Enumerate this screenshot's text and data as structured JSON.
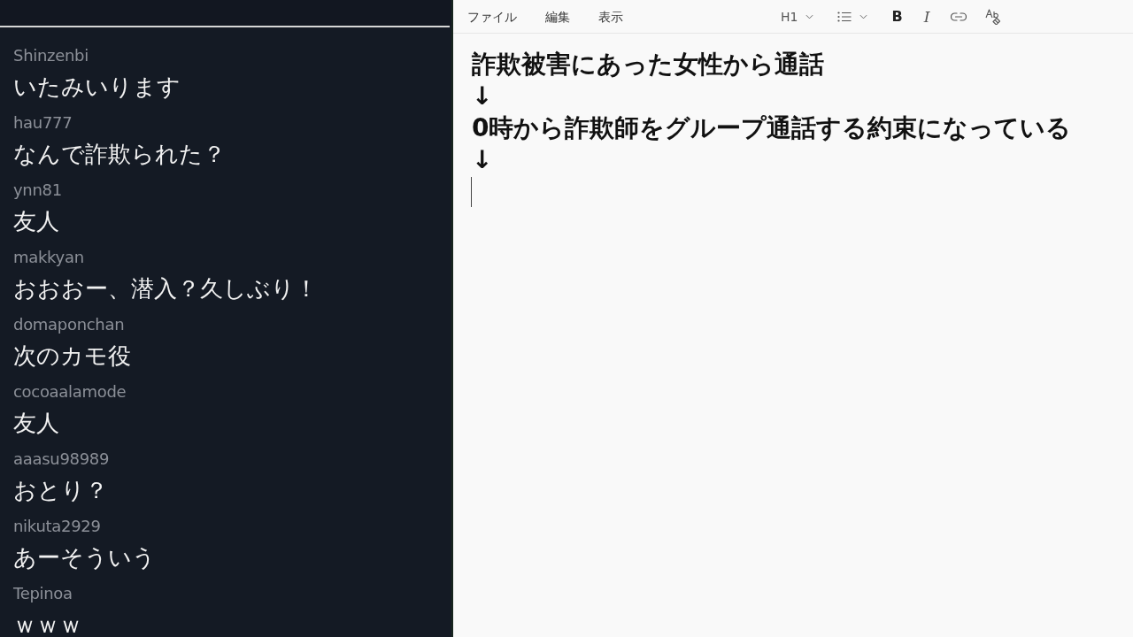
{
  "chat": {
    "messages": [
      {
        "user": "Shinzenbi",
        "text": "いたみいります"
      },
      {
        "user": "hau777",
        "text": "なんで詐欺られた？"
      },
      {
        "user": "ynn81",
        "text": "友人"
      },
      {
        "user": "makkyan",
        "text": "おおおー、潜入？久しぶり！"
      },
      {
        "user": "domaponchan",
        "text": "次のカモ役"
      },
      {
        "user": "cocoaalamode",
        "text": "友人"
      },
      {
        "user": "aaasu98989",
        "text": "おとり？"
      },
      {
        "user": "nikuta2929",
        "text": "あーそういう"
      },
      {
        "user": "Tepinoa",
        "text": "ｗｗｗ"
      }
    ]
  },
  "editor": {
    "menu": [
      "ファイル",
      "編集",
      "表示"
    ],
    "toolbar": [
      {
        "kind": "heading",
        "label": "H1",
        "dropdown": true
      },
      {
        "kind": "list",
        "dropdown": true
      },
      {
        "kind": "bold",
        "label": "B",
        "dropdown": false
      },
      {
        "kind": "italic",
        "label": "I",
        "dropdown": false
      },
      {
        "kind": "link",
        "dropdown": false
      },
      {
        "kind": "spellcheck",
        "dropdown": false
      }
    ],
    "lines": [
      "詐欺被害にあった女性から通話",
      "↓",
      "0時から詐欺師をグループ通話する約束になっている",
      "↓"
    ],
    "caret": true
  }
}
